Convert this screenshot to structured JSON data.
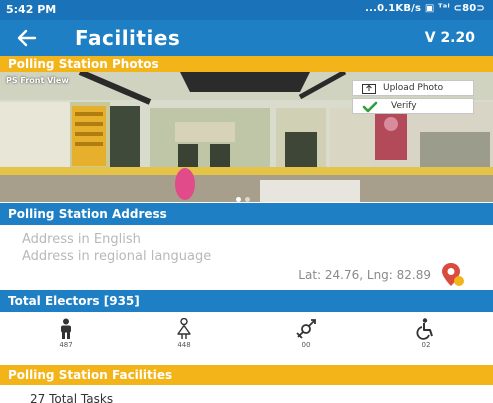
{
  "status_bar": {
    "time": "5:42 PM",
    "right": "...0.1KB/s ▣ ᵀᵃˡ ⊂80⊃"
  },
  "app_bar": {
    "back_icon": "arrow-left-icon",
    "title": "Facilities",
    "version": "V 2.20"
  },
  "photos_section": {
    "header": "Polling Station Photos",
    "photo_label": "PS Front View",
    "upload_label": "Upload Photo",
    "verify_label": "Verify",
    "page_count": 2,
    "current_page": 1
  },
  "address_section": {
    "header": "Polling Station Address",
    "address_english": "Address in English",
    "address_regional": "Address in regional language",
    "latlng": "Lat: 24.76, Lng: 82.89",
    "pin_icon": "map-pin-icon"
  },
  "electors_section": {
    "header": "Total Electors [935]",
    "categories": [
      {
        "icon": "male-icon",
        "count": "487"
      },
      {
        "icon": "female-icon",
        "count": "448"
      },
      {
        "icon": "third-gender-icon",
        "count": "00"
      },
      {
        "icon": "wheelchair-icon",
        "count": "02"
      }
    ]
  },
  "facilities_section": {
    "header": "Polling Station Facilities",
    "tasks": "27 Total Tasks"
  },
  "colors": {
    "primary": "#1f7fc4",
    "accent": "#f3b41a",
    "verify": "#2e9e3a",
    "pin": "#d94c3d"
  }
}
